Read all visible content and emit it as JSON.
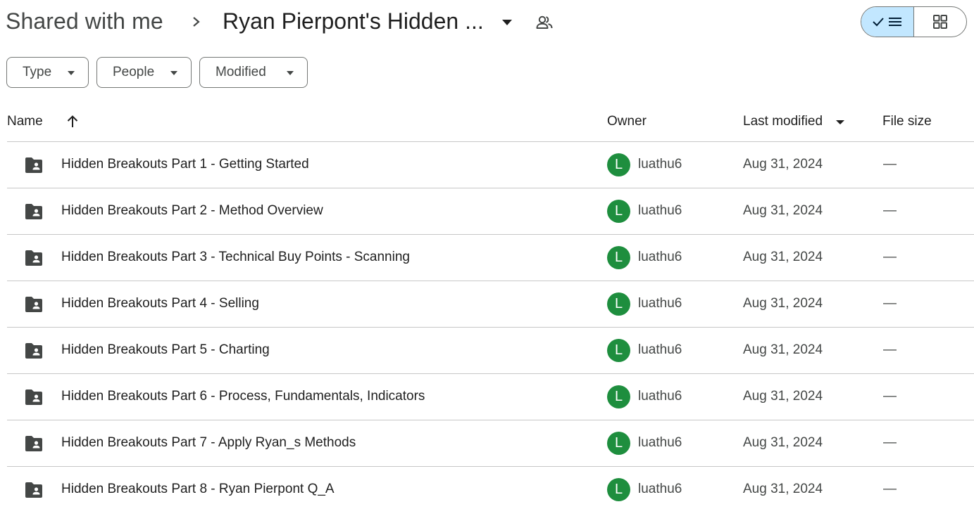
{
  "breadcrumb": {
    "root": "Shared with me",
    "current": "Ryan Pierpont's Hidden ..."
  },
  "icons": {
    "breadcrumb_separator": "chevron-right-icon",
    "folder_menu": "arrow-drop-down-icon",
    "shared": "people-icon",
    "list_view": "check-list-icon",
    "grid_view": "grid-icon",
    "sort": "arrow-upward-icon",
    "row_icon": "shared-folder-icon"
  },
  "view_toggle": {
    "selected": "list"
  },
  "filters": {
    "type": "Type",
    "people": "People",
    "modified": "Modified"
  },
  "columns": {
    "name": "Name",
    "owner": "Owner",
    "last_modified": "Last modified",
    "file_size": "File size"
  },
  "rows": [
    {
      "name": "Hidden Breakouts Part 1 - Getting Started",
      "owner_initial": "L",
      "owner": "luathu6",
      "modified": "Aug 31, 2024",
      "size": "—"
    },
    {
      "name": "Hidden Breakouts Part 2 - Method Overview",
      "owner_initial": "L",
      "owner": "luathu6",
      "modified": "Aug 31, 2024",
      "size": "—"
    },
    {
      "name": "Hidden Breakouts Part 3 - Technical Buy Points - Scanning",
      "owner_initial": "L",
      "owner": "luathu6",
      "modified": "Aug 31, 2024",
      "size": "—"
    },
    {
      "name": "Hidden Breakouts Part 4 - Selling",
      "owner_initial": "L",
      "owner": "luathu6",
      "modified": "Aug 31, 2024",
      "size": "—"
    },
    {
      "name": "Hidden Breakouts Part 5 - Charting",
      "owner_initial": "L",
      "owner": "luathu6",
      "modified": "Aug 31, 2024",
      "size": "—"
    },
    {
      "name": "Hidden Breakouts Part 6 - Process, Fundamentals, Indicators",
      "owner_initial": "L",
      "owner": "luathu6",
      "modified": "Aug 31, 2024",
      "size": "—"
    },
    {
      "name": "Hidden Breakouts Part 7 - Apply Ryan_s Methods",
      "owner_initial": "L",
      "owner": "luathu6",
      "modified": "Aug 31, 2024",
      "size": "—"
    },
    {
      "name": "Hidden Breakouts Part 8 - Ryan Pierpont Q_A",
      "owner_initial": "L",
      "owner": "luathu6",
      "modified": "Aug 31, 2024",
      "size": "—"
    }
  ],
  "colors": {
    "accent_selected": "#c2e7ff",
    "avatar": "#1e8e3e",
    "border": "#747775",
    "divider": "#c7c7c7"
  }
}
